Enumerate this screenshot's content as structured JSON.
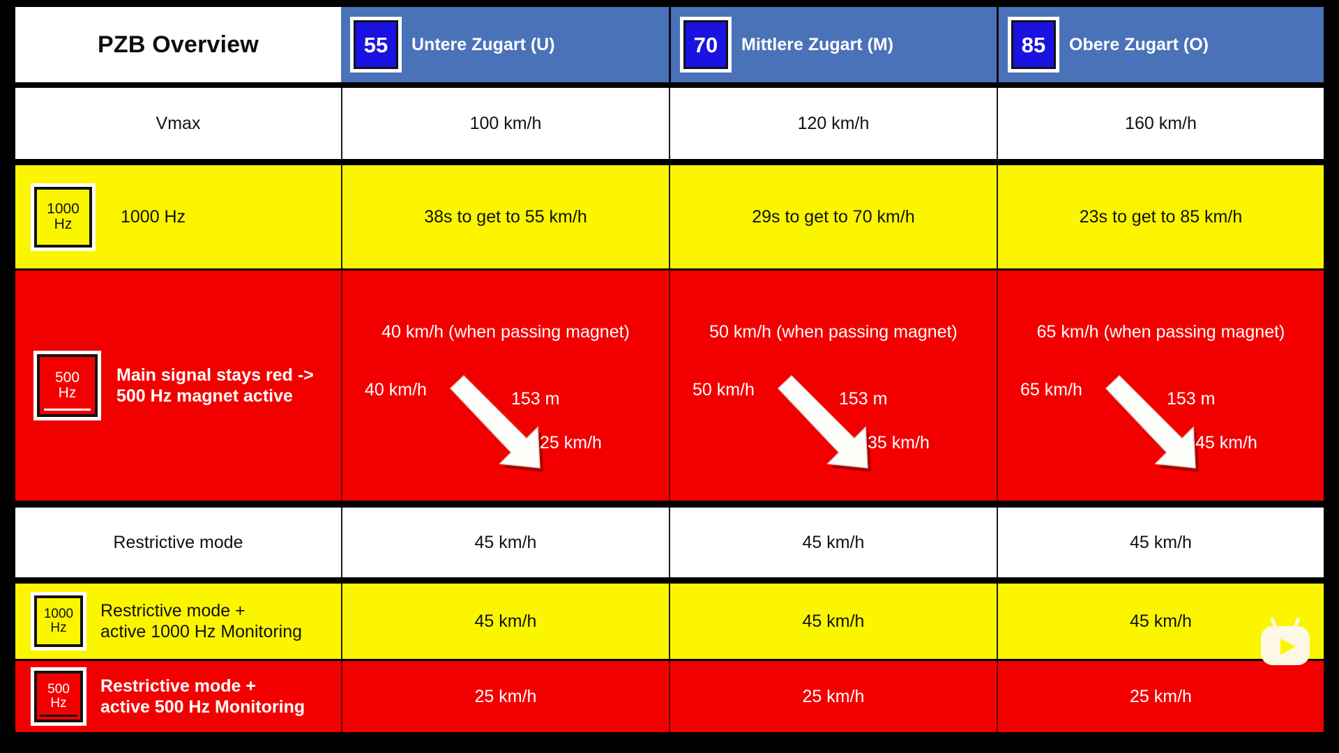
{
  "title": "PZB Overview",
  "colors": {
    "blue_header": "#4a72b8",
    "badge_blue": "#1a12e0",
    "yellow": "#fbf500",
    "red": "#f20000",
    "white": "#ffffff",
    "black": "#000000"
  },
  "columns": [
    {
      "badge": "55",
      "label": "Untere Zugart (U)"
    },
    {
      "badge": "70",
      "label": "Mittlere Zugart (M)"
    },
    {
      "badge": "85",
      "label": "Obere Zugart (O)"
    }
  ],
  "rows": {
    "vmax": {
      "label": "Vmax",
      "values": [
        "100 km/h",
        "120 km/h",
        "160 km/h"
      ]
    },
    "hz1000": {
      "badge_top": "1000",
      "badge_bottom": "Hz",
      "label": "1000 Hz",
      "values": [
        "38s to get to 55 km/h",
        "29s to get to 70 km/h",
        "23s to get to 85 km/h"
      ]
    },
    "hz500": {
      "badge_top": "500",
      "badge_bottom": "Hz",
      "label": "Main signal stays red ->\n500 Hz magnet active",
      "cells": [
        {
          "passing": "40 km/h (when passing magnet)",
          "start": "40 km/h",
          "distance": "153 m",
          "end": "25 km/h"
        },
        {
          "passing": "50 km/h (when passing magnet)",
          "start": "50 km/h",
          "distance": "153 m",
          "end": "35 km/h"
        },
        {
          "passing": "65 km/h (when passing magnet)",
          "start": "65 km/h",
          "distance": "153 m",
          "end": "45 km/h"
        }
      ]
    },
    "restrictive": {
      "label": "Restrictive mode",
      "values": [
        "45 km/h",
        "45 km/h",
        "45 km/h"
      ]
    },
    "restrictive1000": {
      "badge_top": "1000",
      "badge_bottom": "Hz",
      "label": "Restrictive mode +\nactive 1000 Hz Monitoring",
      "values": [
        "45 km/h",
        "45 km/h",
        "45 km/h"
      ]
    },
    "restrictive500": {
      "badge_top": "500",
      "badge_bottom": "Hz",
      "label": "Restrictive mode +\nactive 500 Hz Monitoring",
      "values": [
        "25 km/h",
        "25 km/h",
        "25 km/h"
      ]
    }
  }
}
